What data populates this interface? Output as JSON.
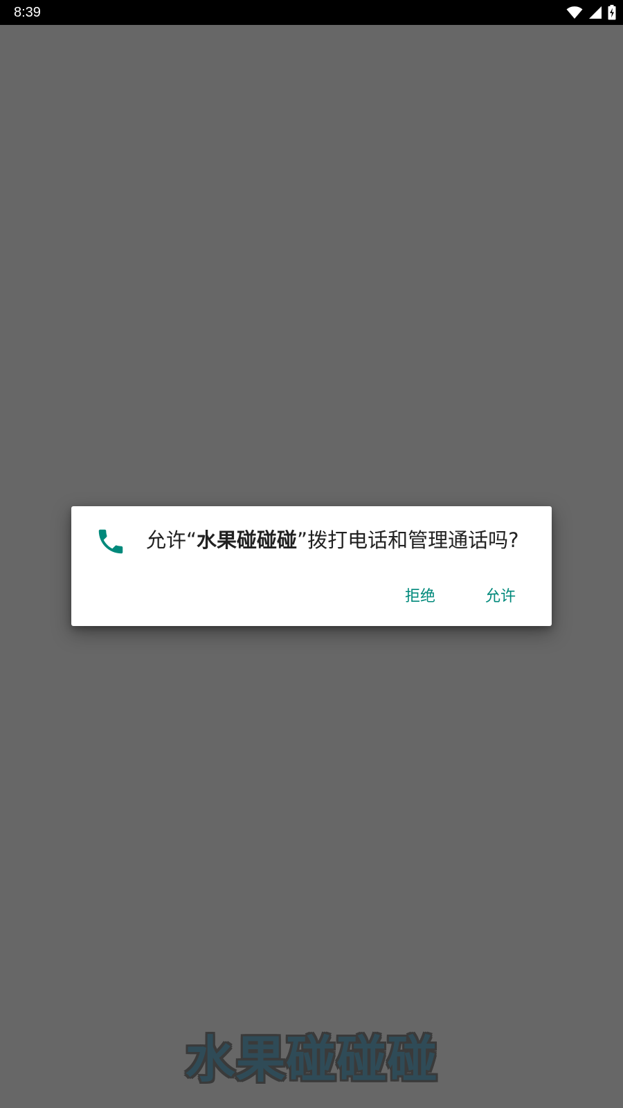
{
  "status_bar": {
    "time": "8:39",
    "icons": [
      "wifi-icon",
      "cellular-signal-icon",
      "battery-charging-icon"
    ]
  },
  "background": {
    "app_title": "水果碰碰碰"
  },
  "permission_dialog": {
    "icon": "phone-icon",
    "accent_color": "#00897B",
    "message_prefix": "允许“",
    "app_name": "水果碰碰碰",
    "message_suffix": "”拨打电话和管理通话吗?",
    "deny_label": "拒绝",
    "allow_label": "允许"
  }
}
